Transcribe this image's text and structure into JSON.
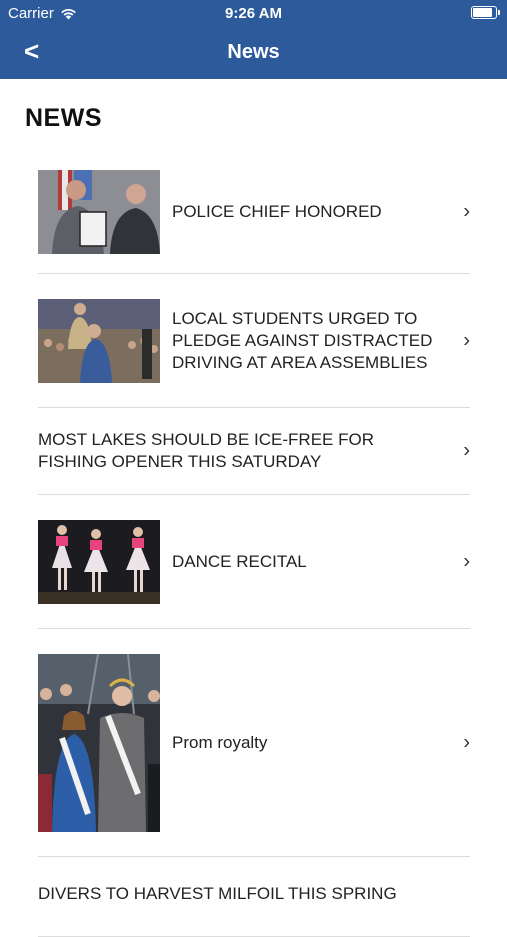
{
  "status_bar": {
    "carrier": "Carrier",
    "time": "9:26 AM",
    "battery_level": 0.8
  },
  "nav": {
    "back_label": "<",
    "title": "News"
  },
  "heading": "NEWS",
  "items": [
    {
      "title": "POLICE CHIEF HONORED",
      "has_image": true
    },
    {
      "title": "LOCAL STUDENTS URGED TO PLEDGE AGAINST DISTRACTED DRIVING AT AREA ASSEMBLIES",
      "has_image": true
    },
    {
      "title": "MOST LAKES SHOULD BE ICE-FREE FOR FISHING OPENER THIS SATURDAY",
      "has_image": false
    },
    {
      "title": "DANCE RECITAL",
      "has_image": true
    },
    {
      "title": "Prom royalty",
      "has_image": true
    },
    {
      "title": "DIVERS TO HARVEST MILFOIL THIS SPRING",
      "has_image": false
    }
  ],
  "colors": {
    "nav_bg": "#2d5a9b",
    "text": "#222222",
    "divider": "#dcdcdc"
  },
  "icons": {
    "chevron": "chevron-right-icon",
    "wifi": "wifi-icon",
    "battery": "battery-icon"
  }
}
